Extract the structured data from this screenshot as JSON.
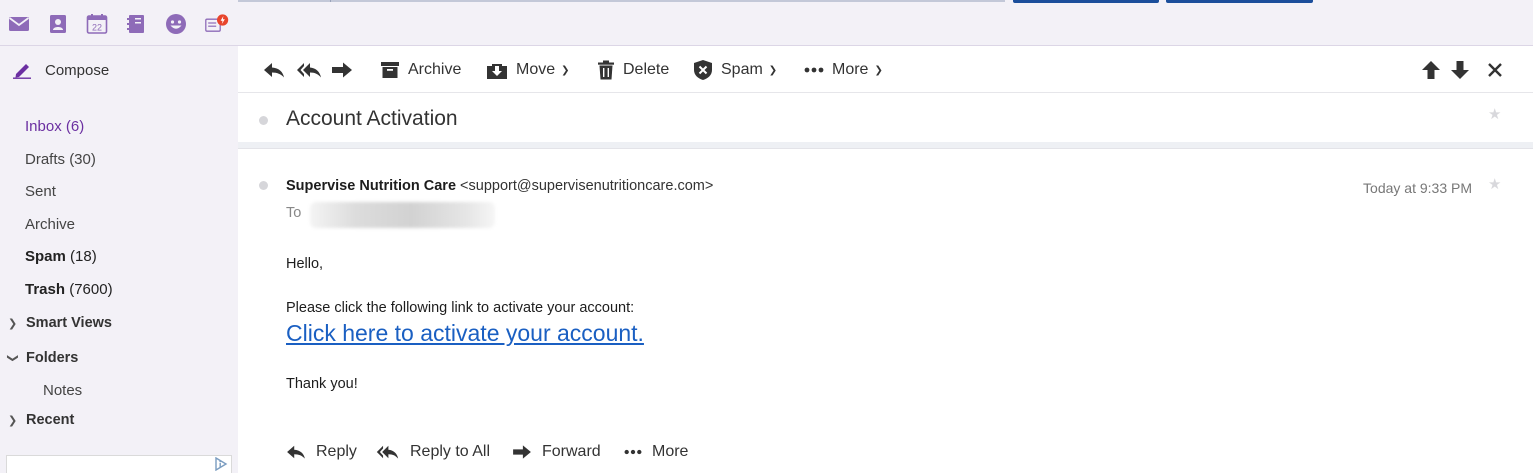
{
  "colors": {
    "accent": "#6b2fa1",
    "link": "#1a5fc2",
    "sidebar_bg": "#f3f1f7",
    "notification": "#e8452c"
  },
  "app_icons": [
    "mail-icon",
    "contacts-icon",
    "calendar-icon",
    "notepad-icon",
    "messenger-icon",
    "news-icon"
  ],
  "calendar_day": "22",
  "sidebar": {
    "compose_label": "Compose",
    "folders": [
      {
        "label": "Inbox",
        "count": "(6)"
      },
      {
        "label": "Drafts",
        "count": "(30)"
      },
      {
        "label": "Sent",
        "count": ""
      },
      {
        "label": "Archive",
        "count": ""
      },
      {
        "label": "Spam",
        "count": "(18)"
      },
      {
        "label": "Trash",
        "count": "(7600)"
      }
    ],
    "sections": {
      "smart_views": "Smart Views",
      "folders": "Folders",
      "notes": "Notes",
      "recent": "Recent"
    }
  },
  "toolbar": {
    "archive": "Archive",
    "move": "Move",
    "delete": "Delete",
    "spam": "Spam",
    "more": "More"
  },
  "message": {
    "subject": "Account Activation",
    "from_name": "Supervise Nutrition Care",
    "from_email": "<support@supervisenutritioncare.com>",
    "to_label": "To",
    "date": "Today at 9:33 PM",
    "greeting": "Hello,",
    "instruction": "Please click the following link to activate your account:",
    "link_text": "Click here to activate your account.",
    "closing": "Thank you!"
  },
  "actions": {
    "reply": "Reply",
    "reply_all": "Reply to All",
    "forward": "Forward",
    "more": "More"
  }
}
